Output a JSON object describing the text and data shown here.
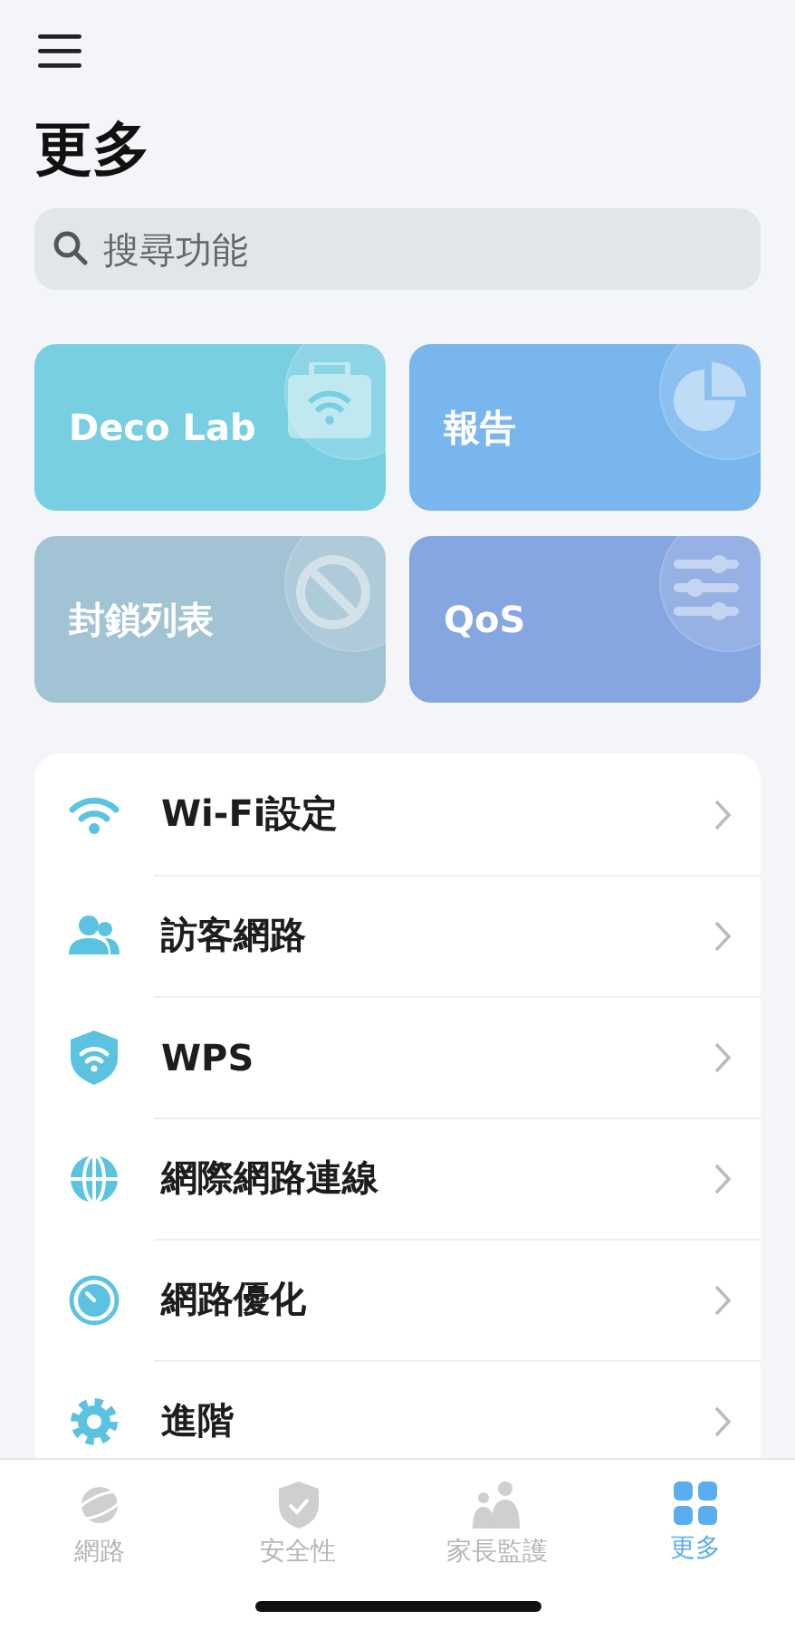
{
  "title": "更多",
  "search": {
    "placeholder": "搜尋功能"
  },
  "tiles": [
    {
      "label": "Deco Lab",
      "kind": "lab",
      "color": "#79cfe2"
    },
    {
      "label": "報告",
      "kind": "report",
      "color": "#79b6ee"
    },
    {
      "label": "封鎖列表",
      "kind": "block",
      "color": "#a2c3d3"
    },
    {
      "label": "QoS",
      "kind": "qos",
      "color": "#85a6e0"
    }
  ],
  "menu": [
    {
      "label": "Wi-Fi設定",
      "kind": "wifi"
    },
    {
      "label": "訪客網路",
      "kind": "guest"
    },
    {
      "label": "WPS",
      "kind": "wps"
    },
    {
      "label": "網際網路連線",
      "kind": "globe"
    },
    {
      "label": "網路優化",
      "kind": "optimize"
    },
    {
      "label": "進階",
      "kind": "gear"
    }
  ],
  "tabs": [
    {
      "label": "網路",
      "kind": "planet",
      "selected": false
    },
    {
      "label": "安全性",
      "kind": "shield",
      "selected": false
    },
    {
      "label": "家長監護",
      "kind": "family",
      "selected": false
    },
    {
      "label": "更多",
      "kind": "grid",
      "selected": true
    }
  ]
}
